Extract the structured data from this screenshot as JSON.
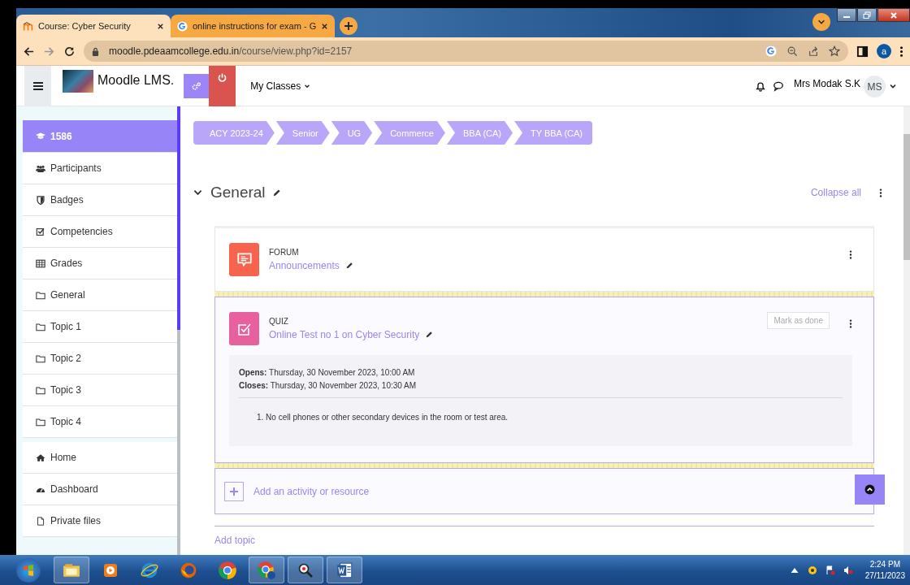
{
  "browser": {
    "tabs": [
      {
        "title": "Course: Cyber Security",
        "selected": true,
        "kind": "moodle"
      },
      {
        "title": "online instructions for exam - G",
        "selected": false,
        "kind": "google"
      }
    ],
    "address_host": "moodle.pdeaamcollege.edu.in",
    "address_path": "/course/view.php?id=2157",
    "profile_initial": "a"
  },
  "header": {
    "site_name": "Moodle LMS.",
    "menu": "My Classes",
    "user_name": "Mrs Modak S.K",
    "avatar_initials": "MS"
  },
  "sidebar": {
    "sections": [
      {
        "items": [
          {
            "label": "1586",
            "selected": true
          },
          {
            "label": "Participants",
            "selected": false
          },
          {
            "label": "Badges",
            "selected": false
          },
          {
            "label": "Competencies",
            "selected": false
          },
          {
            "label": "Grades",
            "selected": false
          },
          {
            "label": "General",
            "selected": false
          },
          {
            "label": "Topic 1",
            "selected": false
          },
          {
            "label": "Topic 2",
            "selected": false
          },
          {
            "label": "Topic 3",
            "selected": false
          },
          {
            "label": "Topic 4",
            "selected": false
          }
        ]
      },
      {
        "items": [
          {
            "label": "Home",
            "selected": false
          },
          {
            "label": "Dashboard",
            "selected": false
          },
          {
            "label": "Private files",
            "selected": false
          }
        ]
      }
    ]
  },
  "breadcrumb": [
    "ACY 2023-24",
    "Senior",
    "UG",
    "Commerce",
    "BBA (CA)",
    "TY BBA (CA)"
  ],
  "section": {
    "title": "General",
    "expanded": true,
    "collapse_label": "Collapse all"
  },
  "activities": [
    {
      "kind": "forum",
      "type_label": "FORUM",
      "name": "Announcements",
      "highlighted": false
    },
    {
      "kind": "quiz",
      "type_label": "QUIZ",
      "name": "Online Test no 1 on Cyber Security",
      "highlighted": true,
      "completion_button": "Mark as done",
      "dates": [
        {
          "label": "Opens:",
          "value": "Thursday, 30 November 2023, 10:00 AM"
        },
        {
          "label": "Closes:",
          "value": "Thursday, 30 November 2023, 10:30 AM"
        }
      ],
      "instructions": [
        {
          "number": "1.",
          "text": "No cell phones or other secondary devices in the room or test area."
        }
      ]
    }
  ],
  "add_activity": "Add an activity or resource",
  "add_topic": "Add topic",
  "taskbar": {
    "time": "2:24 PM",
    "date": "27/11/2023"
  }
}
